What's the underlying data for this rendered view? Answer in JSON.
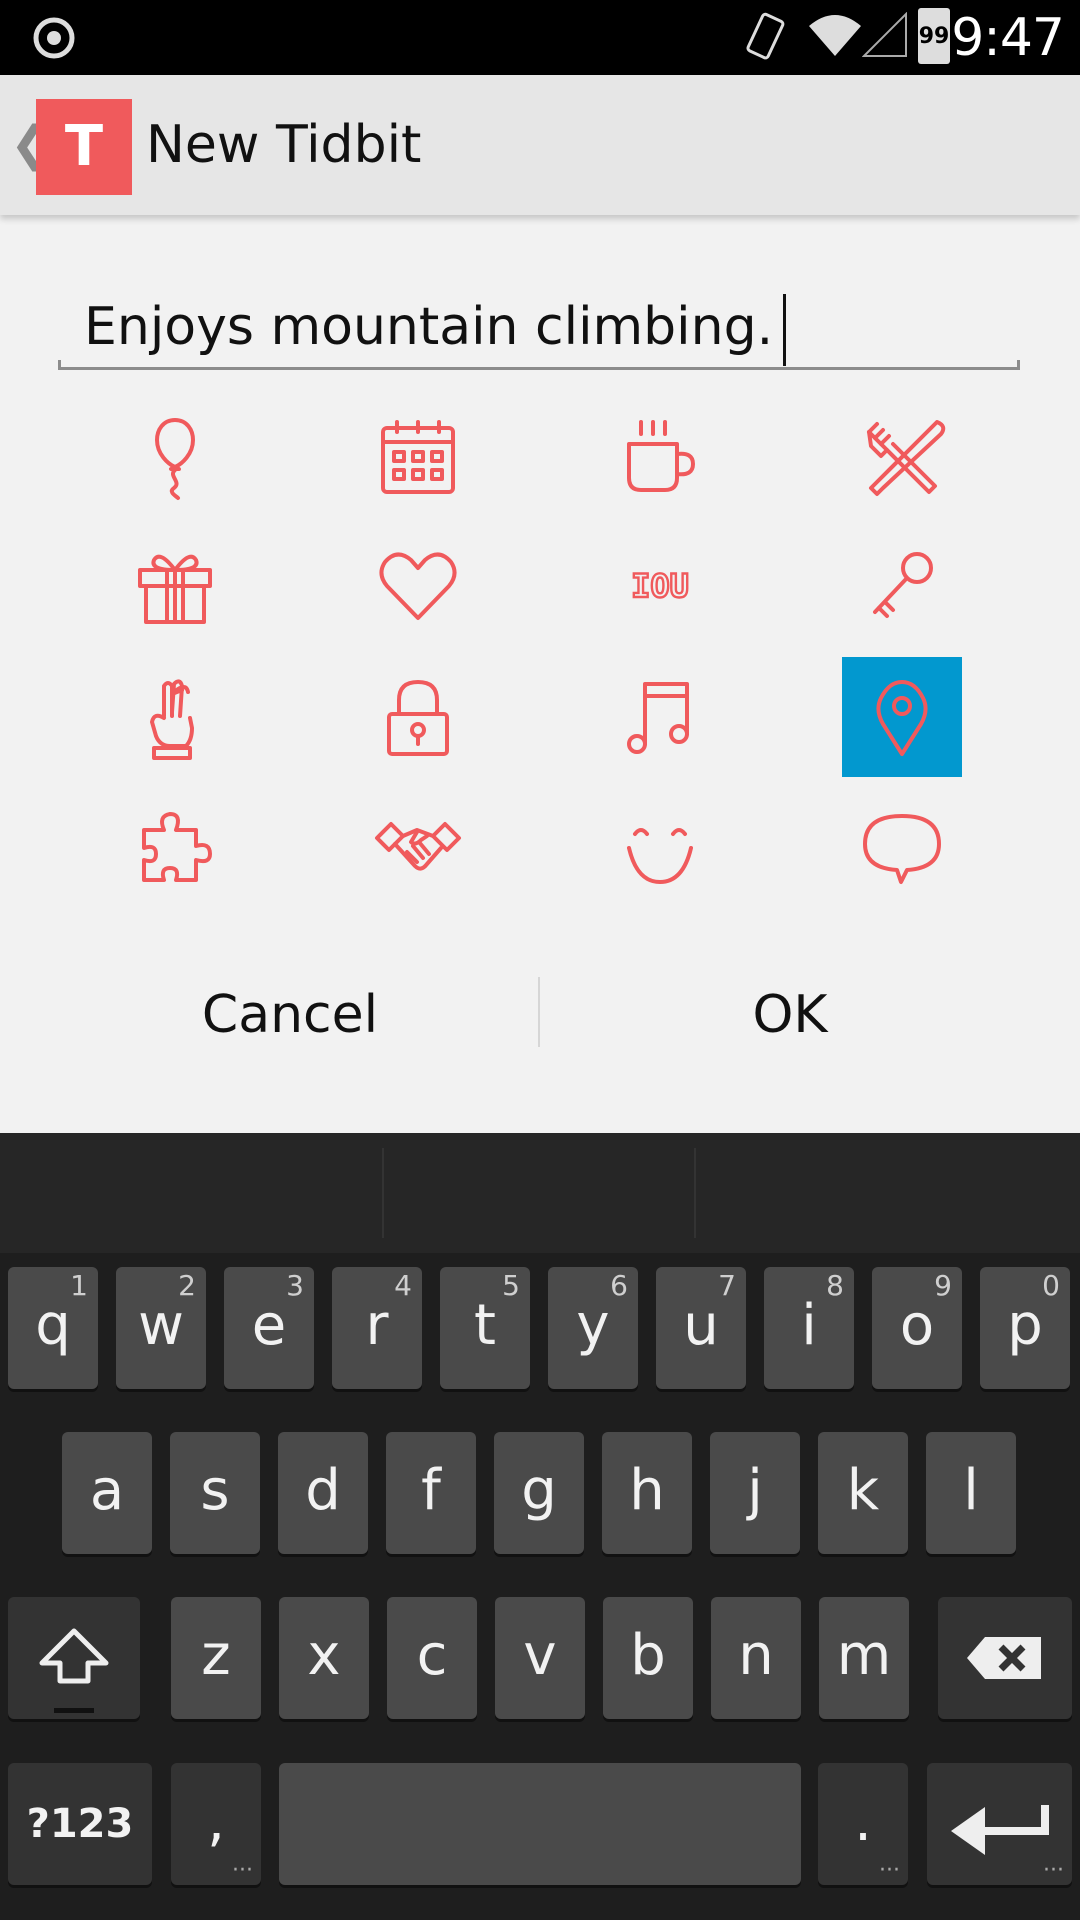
{
  "status_bar": {
    "time": "9:47",
    "battery": "99"
  },
  "action_bar": {
    "back": "❮",
    "logo_letter": "T",
    "title": "New Tidbit"
  },
  "field": {
    "value": "Enjoys mountain climbing."
  },
  "icons": [
    "balloon-icon",
    "calendar-icon",
    "coffee-cup-icon",
    "fork-knife-icon",
    "gift-icon",
    "heart-icon",
    "iou-icon",
    "key-icon",
    "finger-string-icon",
    "lock-icon",
    "music-note-icon",
    "location-pin-icon",
    "puzzle-icon",
    "handshake-icon",
    "smile-icon",
    "speech-bubble-icon"
  ],
  "iou_label": "IOU",
  "selected_icon": "location-pin-icon",
  "colors": {
    "accent": "#f05a5c",
    "selected": "#0298cf"
  },
  "buttons": {
    "cancel": "Cancel",
    "ok": "OK"
  },
  "keyboard": {
    "row1": [
      {
        "k": "q",
        "n": "1"
      },
      {
        "k": "w",
        "n": "2"
      },
      {
        "k": "e",
        "n": "3"
      },
      {
        "k": "r",
        "n": "4"
      },
      {
        "k": "t",
        "n": "5"
      },
      {
        "k": "y",
        "n": "6"
      },
      {
        "k": "u",
        "n": "7"
      },
      {
        "k": "i",
        "n": "8"
      },
      {
        "k": "o",
        "n": "9"
      },
      {
        "k": "p",
        "n": "0"
      }
    ],
    "row2": [
      "a",
      "s",
      "d",
      "f",
      "g",
      "h",
      "j",
      "k",
      "l"
    ],
    "row3": [
      "z",
      "x",
      "c",
      "v",
      "b",
      "n",
      "m"
    ],
    "symbols": "?123",
    "comma": ",",
    "period": "."
  }
}
